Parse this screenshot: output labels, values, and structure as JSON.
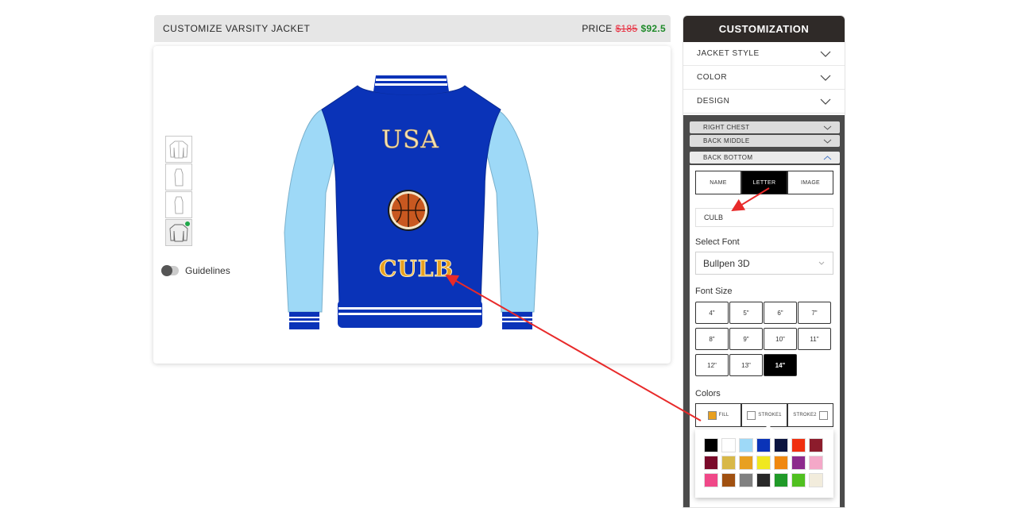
{
  "header": {
    "title": "CUSTOMIZE VARSITY JACKET",
    "price_label": "PRICE",
    "price_old": "$185",
    "price_new": "$92.5"
  },
  "canvas": {
    "guidelines_label": "Guidelines",
    "text_top": "USA",
    "text_bottom": "CULB",
    "colors": {
      "body": "#0a33b8",
      "sleeves": "#9ed9f7",
      "stripe": "#ffffff"
    }
  },
  "panel": {
    "title": "CUSTOMIZATION",
    "sections": [
      {
        "label": "JACKET STYLE"
      },
      {
        "label": "COLOR"
      },
      {
        "label": "DESIGN"
      }
    ],
    "sub_sections": [
      {
        "label": "RIGHT CHEST"
      },
      {
        "label": "BACK MIDDLE"
      },
      {
        "label": "BACK BOTTOM"
      }
    ],
    "tabs": [
      {
        "label": "NAME"
      },
      {
        "label": "LETTER"
      },
      {
        "label": "IMAGE"
      }
    ],
    "letter_value": "CULB",
    "select_font_label": "Select Font",
    "font_value": "Bullpen 3D",
    "font_size_label": "Font Size",
    "sizes": [
      "4\"",
      "5\"",
      "6\"",
      "7\"",
      "8\"",
      "9\"",
      "10\"",
      "11\"",
      "12\"",
      "13\"",
      "14\""
    ],
    "active_size": "14\"",
    "colors_label": "Colors",
    "color_tabs": [
      {
        "label": "FILL",
        "swatch": "#e8a020"
      },
      {
        "label": "STROKE1",
        "swatch": "#ffffff"
      },
      {
        "label": "STROKE2",
        "swatch": "#ffffff"
      }
    ],
    "palette": [
      "#000000",
      "#ffffff",
      "#9ed9f7",
      "#0a33b8",
      "#0b1440",
      "#f03010",
      "#8c1c2c",
      "#7a0a2a",
      "#d8b848",
      "#e8a020",
      "#f0e820",
      "#f08810",
      "#8c2a8c",
      "#f4a8c8",
      "#f04888",
      "#a05010",
      "#808080",
      "#282828",
      "#209a28",
      "#50c020",
      "#f2ecdc"
    ]
  }
}
